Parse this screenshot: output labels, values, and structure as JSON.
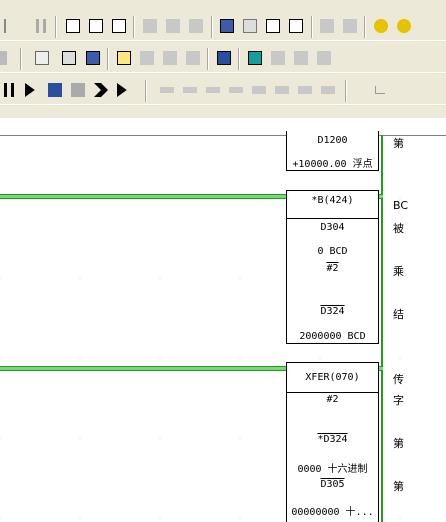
{
  "func_block_1": {
    "addr": "D1200",
    "value": "+10000.00 浮点"
  },
  "func_block_2": {
    "name": "*B(424)",
    "src1": "D304",
    "src1_val": "0 BCD",
    "src2": "#2",
    "dest": "D324",
    "dest_val": "2000000 BCD"
  },
  "func_block_3": {
    "name": "XFER(070)",
    "count": "#2",
    "src": "*D324",
    "src_val": "0000 十六进制",
    "dest": "D305",
    "dest_val": "00000000 十..."
  },
  "comments": [
    "第",
    "BC",
    "被",
    "乘",
    "结",
    "传",
    "字",
    "第",
    "第"
  ]
}
